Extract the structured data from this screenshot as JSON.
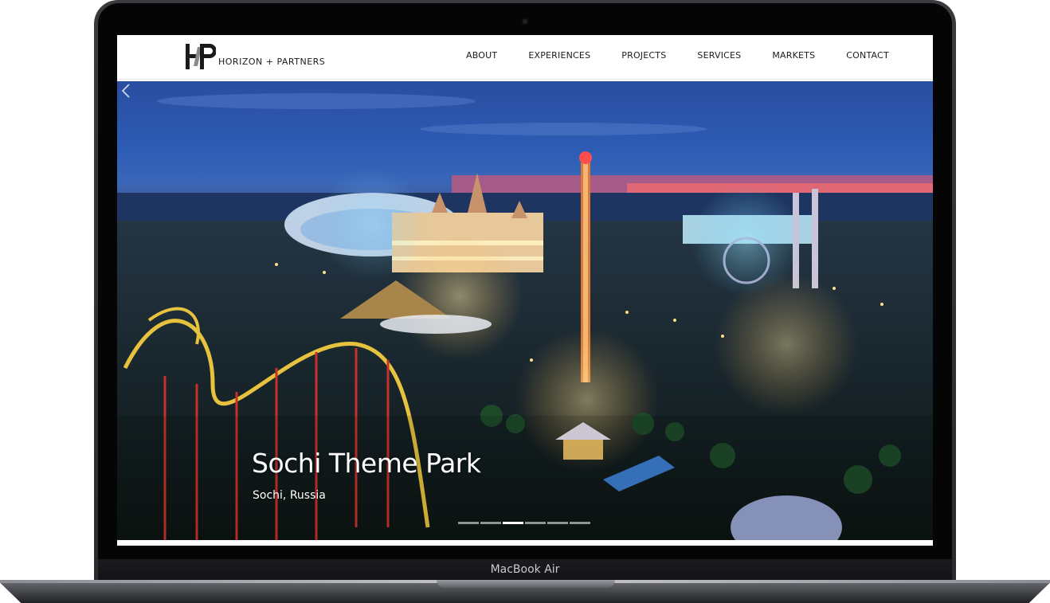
{
  "device": {
    "label": "MacBook Air"
  },
  "site": {
    "logo_text": "HORIZON + PARTNERS",
    "nav": [
      "ABOUT",
      "EXPERIENCES",
      "PROJECTS",
      "SERVICES",
      "MARKETS",
      "CONTACT"
    ]
  },
  "hero": {
    "title": "Sochi Theme Park",
    "subtitle": "Sochi, Russia",
    "slide_count": 6,
    "active_slide": 3
  },
  "icons": {
    "prev": "chevron-left-icon",
    "logo": "hp-logo-icon"
  },
  "colors": {
    "sky_top": "#2a4ea0",
    "sunset": "#d9506a",
    "text": "#1b1b1b"
  }
}
